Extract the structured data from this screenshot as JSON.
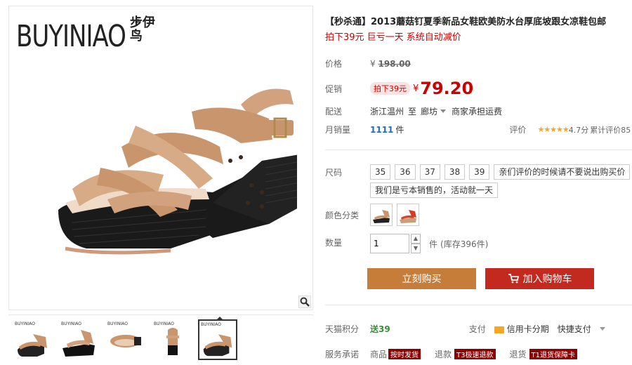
{
  "gallery": {
    "brand_en": "BUYINIAO",
    "brand_cn": "步伊鸟",
    "brand_reg": "®",
    "thumb_brand": "BUYINIAO",
    "zoom_icon": "magnifier-icon"
  },
  "product": {
    "title": "【秒杀通】2013蘑菇钉夏季新品女鞋欧美防水台厚底坡跟女凉鞋包邮",
    "subtitle": "拍下39元 巨亏一天 系统自动减价"
  },
  "price": {
    "orig_label": "价格",
    "orig_yen": "¥",
    "orig_value": "198.00",
    "promo_label": "促销",
    "promo_badge": "拍下39元",
    "yen": "¥",
    "promo_value": "79.20"
  },
  "shipping": {
    "label": "配送",
    "from": "浙江温州",
    "to_word": "至",
    "to": "廊坊",
    "fee": "商家承担运费"
  },
  "sales": {
    "label": "月销量",
    "count": "1111",
    "unit": "件",
    "review_label": "评价",
    "stars": "★★★★★",
    "rating": "4.7分",
    "review_total": "累计评价85"
  },
  "size": {
    "label": "尺码",
    "options": [
      "35",
      "36",
      "37",
      "38",
      "39"
    ],
    "note1": "亲们评价的时候请不要说出购买价",
    "note2": "我们是亏本销售的，活动就一天"
  },
  "color": {
    "label": "颜色分类"
  },
  "quantity": {
    "label": "数量",
    "value": "1",
    "unit": "件",
    "stock": "(库存396件)"
  },
  "buttons": {
    "buy": "立刻购买",
    "cart": "加入购物车"
  },
  "tmall": {
    "points_label": "天猫积分",
    "points_value": "送39",
    "pay_label": "支付",
    "credit": "信用卡分期",
    "quickpay": "快捷支付"
  },
  "service": {
    "label": "服务承诺",
    "item1": "商品",
    "tag1": "按时发货",
    "item2": "退款",
    "tag2": "T3极速退款",
    "item3": "退货",
    "tag3": "T1退货保障卡"
  },
  "colors": {
    "price_red": "#cc0000",
    "buy_btn": "#c67d3a",
    "cart_btn": "#c4291f"
  }
}
